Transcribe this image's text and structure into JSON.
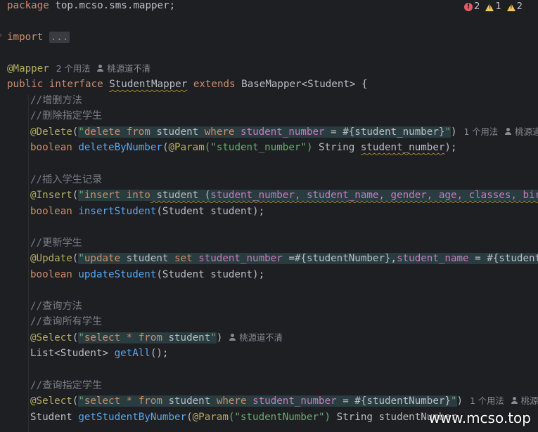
{
  "inspections": {
    "errors": "2",
    "warnings": "1",
    "weak_warnings": "2"
  },
  "hints": {
    "usages_2": "2 个用法",
    "usages_1": "1 个用法",
    "author": "桃源道不清",
    "author_cut": "桃源道不",
    "author_cut2": "桃源道不清"
  },
  "lines": {
    "l1": {
      "kw": "package",
      "pkg": " top.mcso.sms.mapper;"
    },
    "l2": {
      "kw": "import",
      "fold": "..."
    },
    "l3": {
      "ann": "@Mapper"
    },
    "l4": {
      "kw1": "public",
      "kw2": "interface",
      "name": "StudentMapper",
      "kw3": "extends",
      "rest": " BaseMapper<Student> {"
    },
    "l5": {
      "cmt": "//增删方法"
    },
    "l6": {
      "cmt": "//删除指定学生"
    },
    "l7": {
      "ann": "@Delete",
      "open": "(",
      "q1": "\"",
      "k1": "delete",
      "k2": "from",
      "t1": " student ",
      "k3": "where",
      "col": "student_number",
      "t2": " = #{student_number}",
      "q2": "\"",
      "close": ")"
    },
    "l8": {
      "kw": "boolean",
      "fn": "deleteByNumber",
      "open": "(",
      "ann": "@Param",
      "str": "(\"student_number\")",
      "t": " String ",
      "param": "student_number",
      "end": ");"
    },
    "l9": {
      "cmt": "//插入学生记录"
    },
    "l10": {
      "ann": "@Insert",
      "open": "(",
      "q1": "\"",
      "k1": "insert",
      "k2": "into",
      "t1": " student (",
      "cols": "student_number, student_name, gender, age, classes, birthd"
    },
    "l11": {
      "kw": "boolean",
      "fn": "insertStudent",
      "rest": "(Student student);"
    },
    "l12": {
      "cmt": "//更新学生"
    },
    "l13": {
      "ann": "@Update",
      "open": "(",
      "q1": "\"",
      "k1": "update",
      "t1": " student ",
      "k2": "set",
      "col1": "student_number",
      "t2": " =#{studentNumber},",
      "col2": "student_name",
      "t3": " = #{studentNam"
    },
    "l14": {
      "kw": "boolean",
      "fn": "updateStudent",
      "rest": "(Student student);"
    },
    "l15": {
      "cmt": "//查询方法"
    },
    "l16": {
      "cmt": "//查询所有学生"
    },
    "l17": {
      "ann": "@Select",
      "open": "(",
      "q1": "\"",
      "k1": "select",
      "star": " * ",
      "k2": "from",
      "t1": " student",
      "q2": "\"",
      "close": ")"
    },
    "l18": {
      "t": "List<Student> ",
      "fn": "getAll",
      "end": "();"
    },
    "l19": {
      "cmt": "//查询指定学生"
    },
    "l20": {
      "ann": "@Select",
      "open": "(",
      "q1": "\"",
      "k1": "select",
      "star": " * ",
      "k2": "from",
      "t1": " student ",
      "k3": "where",
      "col": "student_number",
      "t2": " = #{studentNumber}",
      "q2": "\"",
      "close": ")"
    },
    "l21": {
      "t": "Student ",
      "fn": "getStudentByNumber",
      "open": "(",
      "ann": "@Param",
      "str": "(\"studentNumber\")",
      "rest": " String studentNumber"
    }
  },
  "watermark": "www.mcso.top"
}
